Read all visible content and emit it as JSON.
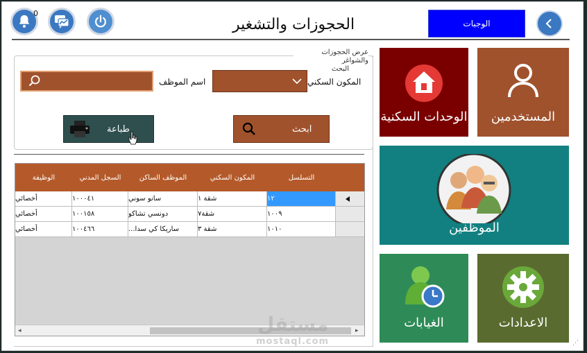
{
  "header": {
    "title": "الحجوزات والتشغير",
    "notification_count": "0",
    "blue_button_label": "الوجبات"
  },
  "tiles": {
    "users": "المستخدمين",
    "housing_units": "الوحدات السكنية",
    "employees": "الموظفين",
    "settings": "الاعدادات",
    "absences": "الغيابات"
  },
  "search_panel": {
    "group_title_line1": "عرض الحجوزات والشواغر",
    "group_title_line2": "البحث",
    "housing_label": "المكون السكني",
    "employee_label": "اسم الموظف",
    "search_button": "ابحث",
    "print_button": "طباعة"
  },
  "table": {
    "columns": [
      "التسلسل",
      "المكون السكني",
      "الموظف الساكن",
      "السجل المدني",
      "الوظيفة"
    ],
    "rows": [
      {
        "seq": "١٢",
        "unit": "شقة ١",
        "resident": "سانو سوني",
        "civil_id": "١٠٠٠٤١",
        "job": "أخصائي"
      },
      {
        "seq": "١٠٠٩",
        "unit": "شقة٧",
        "resident": "دونسي تشاكو",
        "civil_id": "١٠٠١٥٨",
        "job": "أخصائي"
      },
      {
        "seq": "١٠١٠",
        "unit": "شقة ٣",
        "resident": "ساريكا كي سدا...",
        "civil_id": "١٠٠٤٦٦",
        "job": "أخصائي"
      }
    ]
  },
  "watermark": {
    "logo_text": "مستقل",
    "url_text": "mostaql.com"
  },
  "colors": {
    "tile_brown": "#a0522d",
    "tile_dark_red": "#7a0000",
    "tile_teal": "#128080",
    "tile_olive": "#5a6b30",
    "tile_green": "#2e8b57",
    "header_blue": "#0000ff",
    "grid_header": "#b45a2a",
    "print_button": "#2f4f4f",
    "selected_cell": "#3399ff"
  }
}
